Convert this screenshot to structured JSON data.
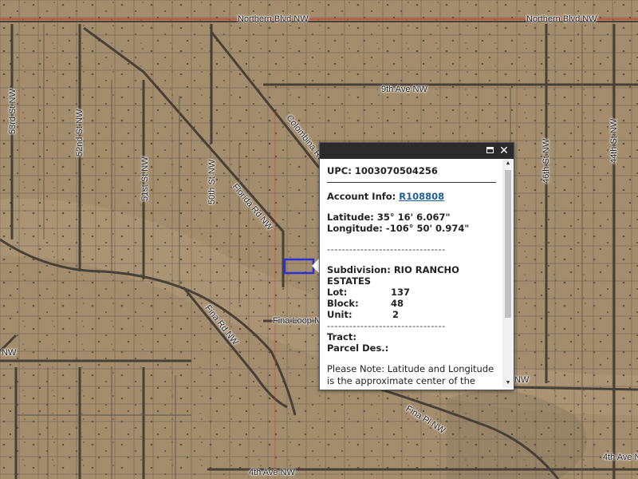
{
  "roads": {
    "northern_blvd_left": "Northern Blvd NW",
    "northern_blvd_right": "Northern Blvd NW",
    "ave_9th": "9th Ave NW",
    "colombine": "Colombina Rd",
    "st_53rd": "53rd St NW",
    "st_52nd": "52nd St NW",
    "st_51st": "51st St NW",
    "st_50th": "50th St NW",
    "florida_rd": "Florida Rd NW",
    "st_46th": "46th St NW",
    "st_44th": "44th St NW",
    "fina_loop": "Fina Loop N",
    "fina_rd": "Fina Rd NW",
    "fina_pl": "Fina Pl NW",
    "ave_4th": "4th Ave NW",
    "ave_4th_right": "4th Ave NW",
    "nw_left": "NW",
    "nw_right": "NW"
  },
  "popup": {
    "upc_label": "UPC:",
    "upc_value": "1003070504256",
    "account_label": "Account Info:",
    "account_value": "R108808",
    "latitude_label": "Latitude:",
    "latitude_value": "35° 16' 6.067\"",
    "longitude_label": "Longitude:",
    "longitude_value": "-106° 50' 0.974\"",
    "dashes": "--------------------------------",
    "subdivision_label": "Subdivision:",
    "subdivision_value": "RIO RANCHO ESTATES",
    "lot_label": "Lot:",
    "lot_value": "137",
    "block_label": "Block:",
    "block_value": "48",
    "unit_label": "Unit:",
    "unit_value": "2",
    "tract_label": "Tract:",
    "parcel_label": "Parcel Des.:",
    "note": "Please Note: Latitude and Longitude is the approximate center of the parcel shown"
  },
  "icons": {
    "maximize": "maximize-icon",
    "close": "close-icon"
  },
  "colors": {
    "terrain": "#a08a6a",
    "road_line": "#3c3c3c",
    "parcel_line": "#6a6a6a",
    "northern_blvd_line": "#d9342b",
    "selected_parcel": "#2a2fd6",
    "popup_bar": "#2b2b2b",
    "link": "#1f5e96"
  }
}
